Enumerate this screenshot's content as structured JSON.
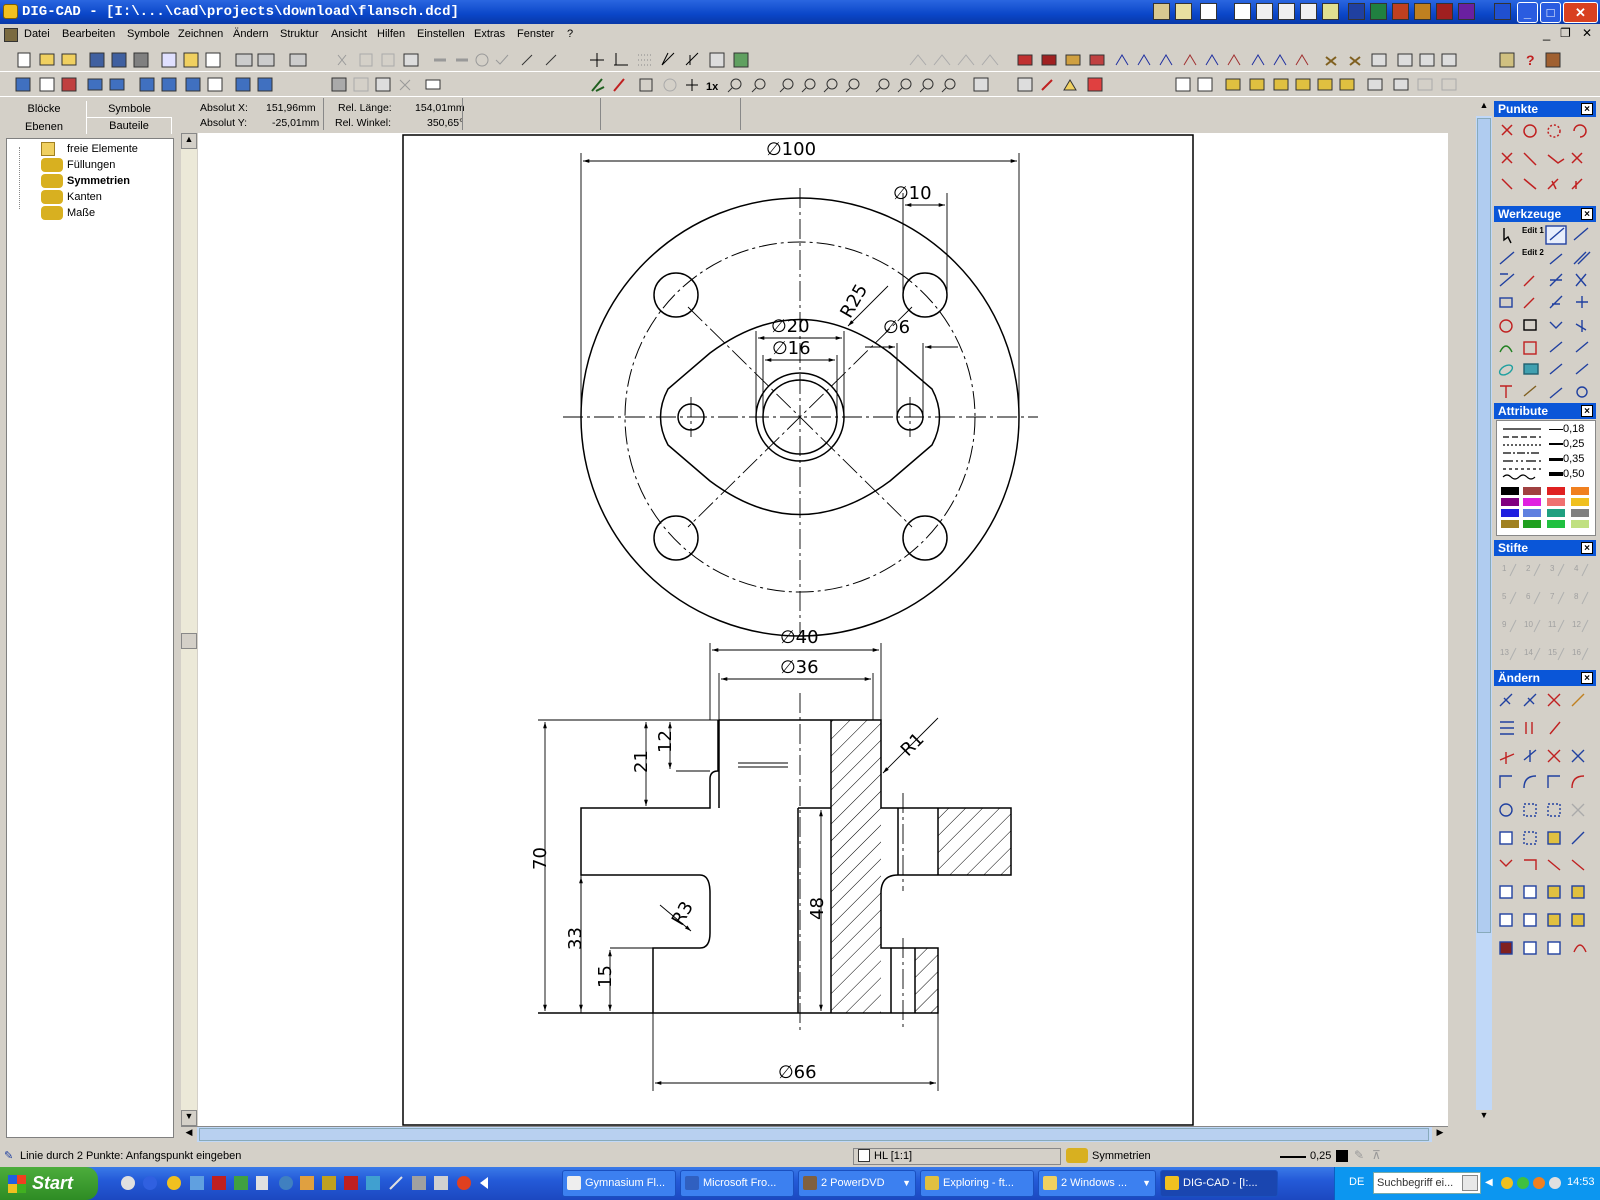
{
  "window": {
    "title": "DIG-CAD - [I:\\...\\cad\\projects\\download\\flansch.dcd]"
  },
  "menu": {
    "items": [
      "Datei",
      "Bearbeiten",
      "Symbole",
      "Zeichnen",
      "Ändern",
      "Struktur",
      "Ansicht",
      "Hilfen",
      "Einstellen",
      "Extras",
      "Fenster",
      "?"
    ]
  },
  "tabs": {
    "bloecke": "Blöcke",
    "symbole": "Symbole",
    "ebenen": "Ebenen",
    "bauteile": "Bauteile"
  },
  "coords": {
    "absx_label": "Absolut X:",
    "absx_value": "151,96mm",
    "absy_label": "Absolut Y:",
    "absy_value": "-25,01mm",
    "rel_len_label": "Rel. Länge:",
    "rel_len_value": "154,01mm",
    "rel_ang_label": "Rel. Winkel:",
    "rel_ang_value": "350,65°"
  },
  "tree": {
    "items": [
      "freie Elemente",
      "Füllungen",
      "Symmetrien",
      "Kanten",
      "Maße"
    ]
  },
  "panels": {
    "punkte": "Punkte",
    "werkzeuge": "Werkzeuge",
    "attribute": "Attribute",
    "stifte": "Stifte",
    "aendern": "Ändern"
  },
  "attribute": {
    "widths": [
      "0,18",
      "0,25",
      "0,35",
      "0,50"
    ]
  },
  "stifte": {
    "pens": [
      "1",
      "2",
      "3",
      "4",
      "5",
      "6",
      "7",
      "8",
      "9",
      "10",
      "11",
      "12",
      "13",
      "14",
      "15",
      "16"
    ]
  },
  "werkzeuge": {
    "edit1": "Edit 1",
    "edit2": "Edit 2"
  },
  "toolbar": {
    "zoom_1x": "1x"
  },
  "drawing": {
    "d100": "∅100",
    "d10": "∅10",
    "r25": "R25",
    "d20": "∅20",
    "d16": "∅16",
    "d6": "∅6",
    "d40": "∅40",
    "d36": "∅36",
    "r1": "R1",
    "d21": "21",
    "d12": "12",
    "d70": "70",
    "r3": "R3",
    "d48": "48",
    "d33": "33",
    "d15": "15",
    "d66": "∅66"
  },
  "status": {
    "message": "Linie durch 2 Punkte: Anfangspunkt eingeben",
    "layer": "HL [1:1]",
    "component": "Symmetrien",
    "linewidth": "0,25"
  },
  "taskbar": {
    "start": "Start",
    "tasks": [
      "Gymnasium Fl...",
      "Microsoft Fro...",
      "2 PowerDVD",
      "Exploring - ft...",
      "2 Windows ...",
      "DIG-CAD - [I:..."
    ],
    "lang": "DE",
    "search": "Suchbegriff ei...",
    "clock": "14:53"
  },
  "colors": {
    "title_bar": "#0a46c8",
    "panel_header": "#0a56d8",
    "taskbar": "#245ad8",
    "start_green": "#3c9e30"
  }
}
